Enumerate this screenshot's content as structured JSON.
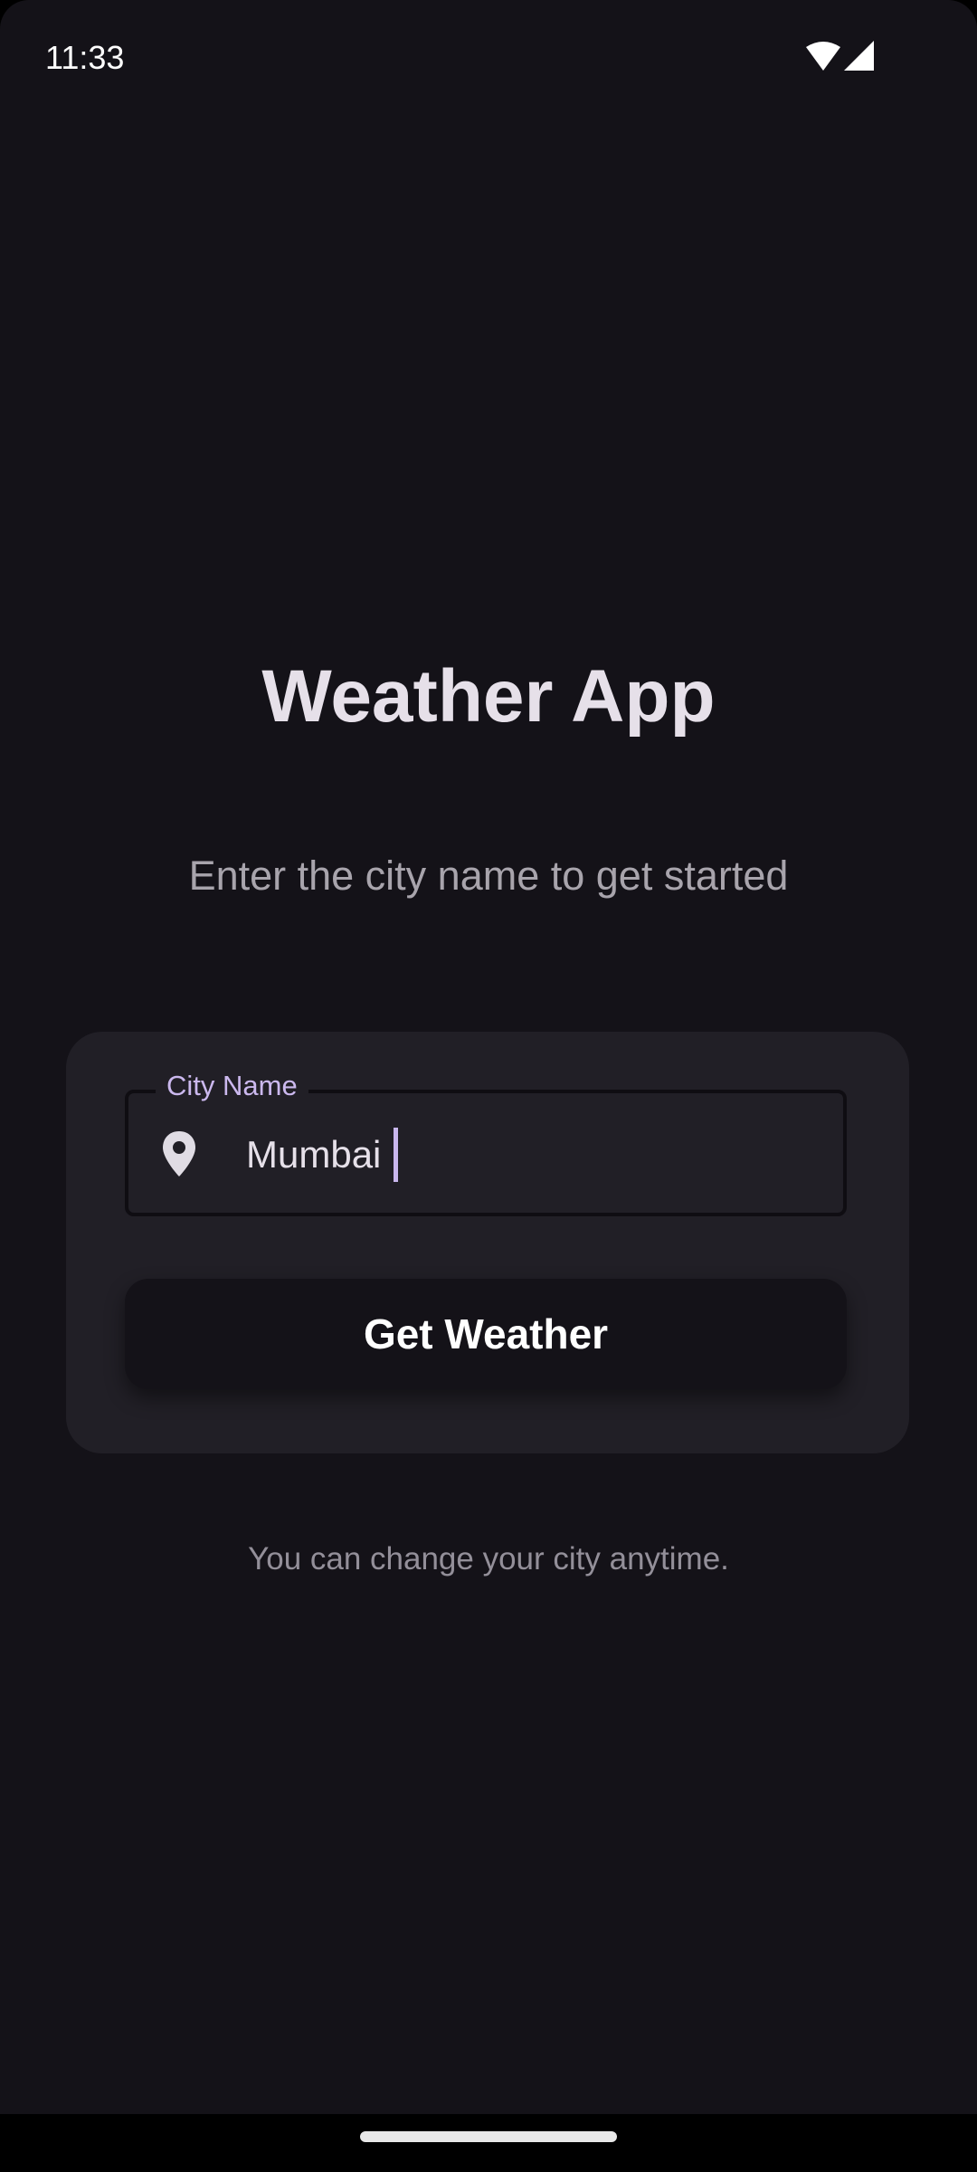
{
  "status_bar": {
    "time": "11:33",
    "icons": [
      "wifi-icon",
      "cell-signal-icon"
    ]
  },
  "main": {
    "title": "Weather App",
    "subtitle": "Enter the city name to get started"
  },
  "form": {
    "city_field": {
      "label": "City Name",
      "value": "Mumbai",
      "icon": "location-pin-icon"
    },
    "submit_label": "Get Weather"
  },
  "hint": "You can change your city anytime.",
  "colors": {
    "background": "#141218",
    "card": "#211F26",
    "accent": "#CBB8EE",
    "title_text": "#E6E0E9",
    "muted_text": "#938F99"
  }
}
